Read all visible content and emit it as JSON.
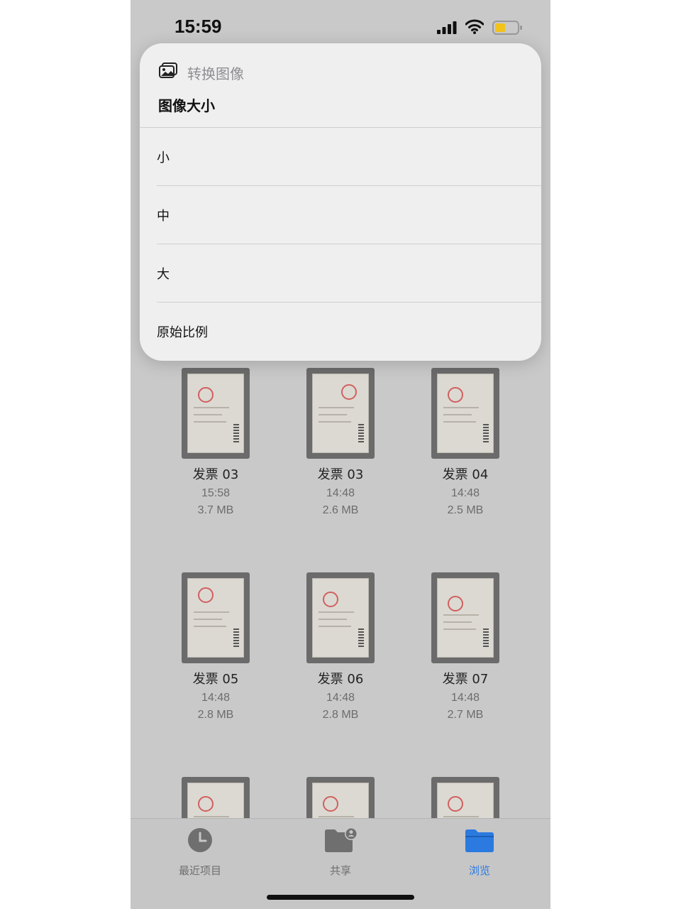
{
  "status": {
    "time": "15:59"
  },
  "popover": {
    "subtitle": "转换图像",
    "title": "图像大小",
    "options": [
      {
        "label": "小"
      },
      {
        "label": "中"
      },
      {
        "label": "大"
      },
      {
        "label": "原始比例"
      }
    ]
  },
  "files": [
    {
      "name": "发票 03",
      "time": "15:58",
      "size": "3.7 MB"
    },
    {
      "name": "发票 03",
      "time": "14:48",
      "size": "2.6 MB"
    },
    {
      "name": "发票 04",
      "time": "14:48",
      "size": "2.5 MB"
    },
    {
      "name": "发票 05",
      "time": "14:48",
      "size": "2.8 MB"
    },
    {
      "name": "发票 06",
      "time": "14:48",
      "size": "2.8 MB"
    },
    {
      "name": "发票 07",
      "time": "14:48",
      "size": "2.7 MB"
    }
  ],
  "tabs": [
    {
      "label": "最近项目",
      "icon": "clock-icon"
    },
    {
      "label": "共享",
      "icon": "shared-folder-icon"
    },
    {
      "label": "浏览",
      "icon": "folder-icon",
      "active": true
    }
  ],
  "colors": {
    "accent": "#2b7ae0",
    "backdrop": "#c9c9c9",
    "popover": "#efefef"
  }
}
